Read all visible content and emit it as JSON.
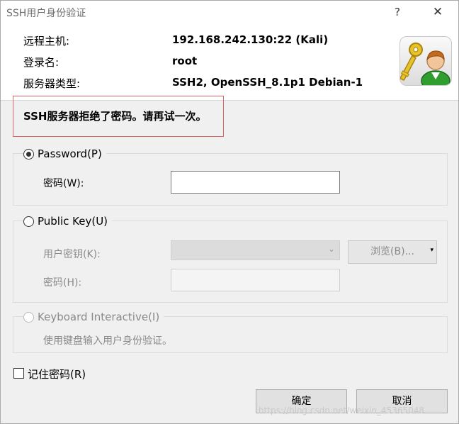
{
  "window": {
    "title": "SSH用户身份验证",
    "help_glyph": "?",
    "close_glyph": "✕"
  },
  "info": {
    "host_label": "远程主机:",
    "host_value": "192.168.242.130:22 (Kali)",
    "login_label": "登录名:",
    "login_value": "root",
    "server_type_label": "服务器类型:",
    "server_type_value": "SSH2, OpenSSH_8.1p1 Debian-1",
    "icon": "user-key-icon"
  },
  "error": {
    "message": "SSH服务器拒绝了密码。请再试一次。",
    "border_color": "#e06464"
  },
  "password_method": {
    "label": "Password(P)",
    "checked": true,
    "password_label": "密码(W):",
    "password_value": ""
  },
  "public_key_method": {
    "label": "Public Key(U)",
    "checked": false,
    "user_key_label": "用户密钥(K):",
    "user_key_value": "",
    "browse_label": "浏览(B)...",
    "password_label": "密码(H):",
    "password_value": ""
  },
  "keyboard_method": {
    "label": "Keyboard Interactive(I)",
    "checked": false,
    "description": "使用键盘输入用户身份验证。"
  },
  "remember": {
    "label": "记住密码(R)",
    "checked": false
  },
  "buttons": {
    "ok_label": "确定",
    "cancel_label": "取消"
  },
  "watermark": "https://blog.csdn.net/weixin_45365048"
}
